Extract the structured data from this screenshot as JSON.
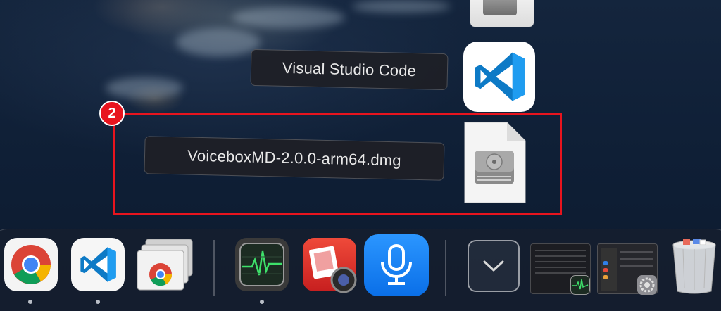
{
  "stack": {
    "items": [
      {
        "label": "Visual Studio Code",
        "icon": "vscode-icon"
      },
      {
        "label": "VoiceboxMD-2.0.0-arm64.dmg",
        "icon": "disk-image-icon"
      }
    ]
  },
  "annotation": {
    "badge": "2",
    "color": "#e8141e"
  },
  "dock": {
    "apps": [
      {
        "name": "Google Chrome",
        "icon": "chrome-icon",
        "running": true
      },
      {
        "name": "Visual Studio Code",
        "icon": "vscode-icon",
        "running": true
      },
      {
        "name": "Chrome Apps",
        "icon": "chrome-apps-icon",
        "running": false
      },
      {
        "name": "Activity Monitor",
        "icon": "activity-monitor-icon",
        "running": true
      },
      {
        "name": "Photo Booth",
        "icon": "photo-booth-icon",
        "running": false
      },
      {
        "name": "Voice Recorder",
        "icon": "microphone-icon",
        "running": false
      }
    ],
    "stack_button_icon": "chevron-down-icon",
    "minimized_windows": [
      "Activity Monitor window",
      "System Settings window"
    ],
    "trash_icon": "trash-full-icon"
  }
}
